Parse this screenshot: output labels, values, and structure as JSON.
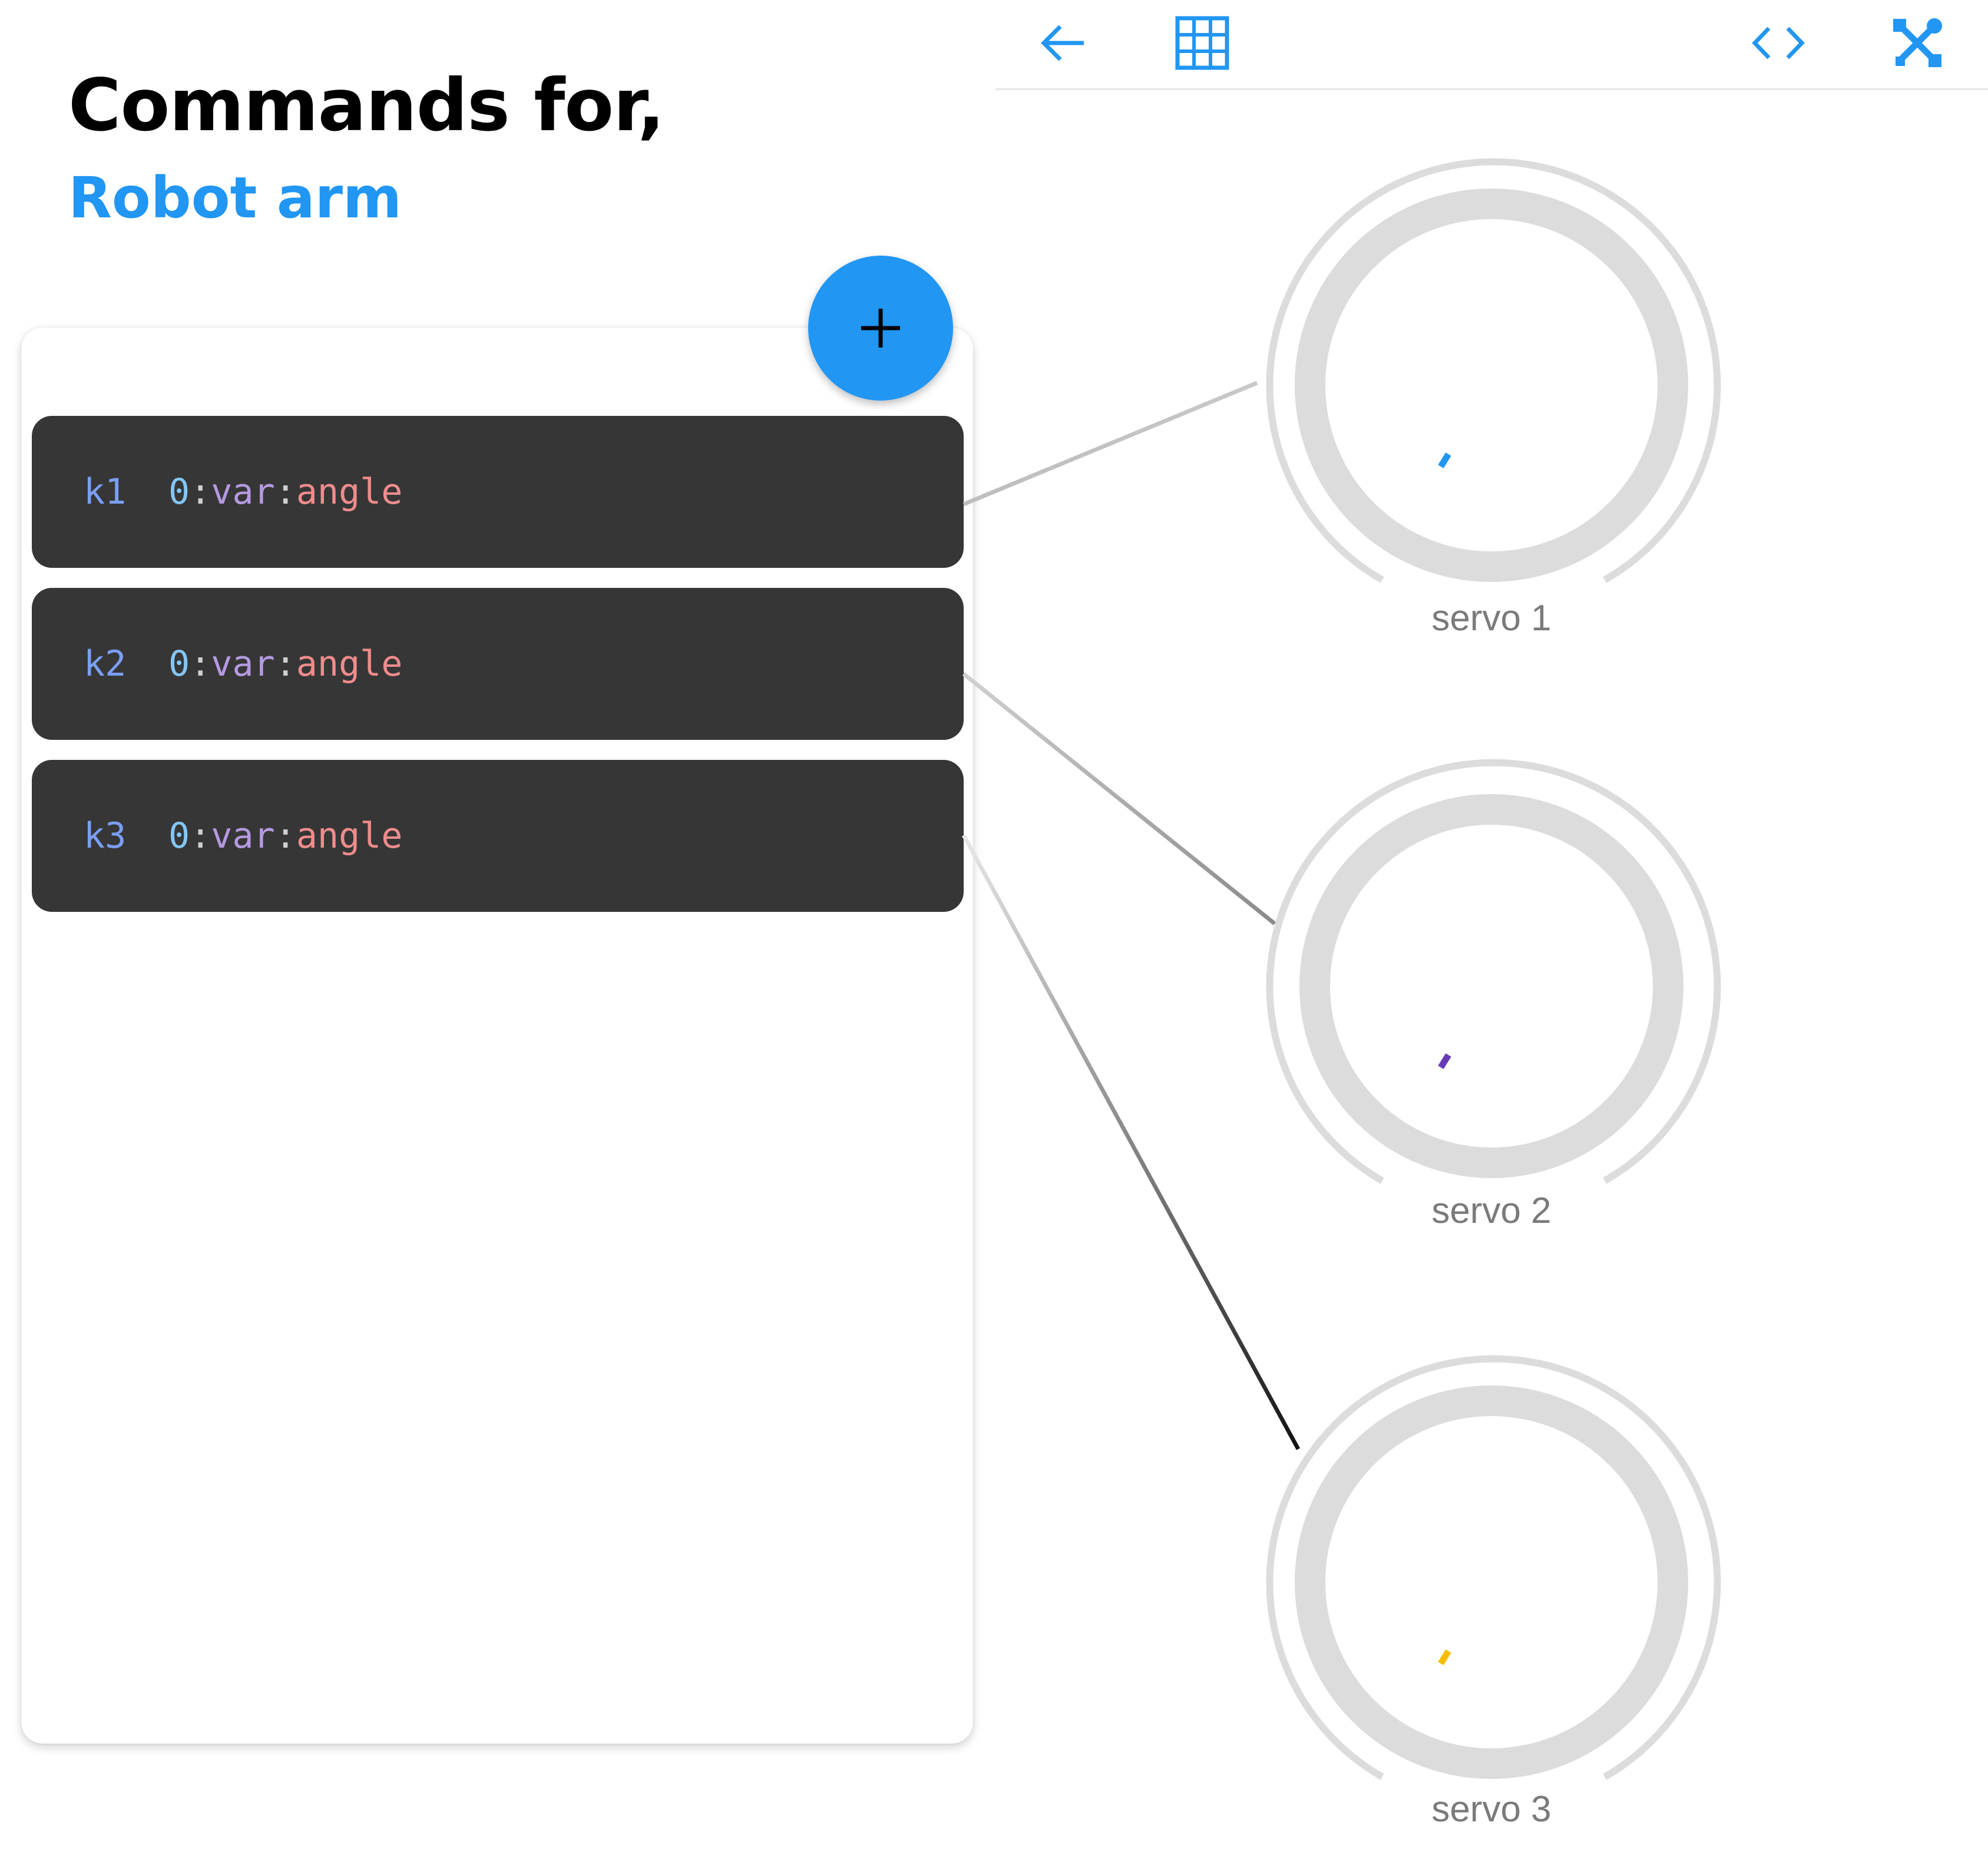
{
  "header": {
    "title": "Commands for,",
    "device_name": "Robot arm"
  },
  "add_button": {
    "label": "+"
  },
  "commands": [
    {
      "key": "k1",
      "index": "0",
      "sep1": ":",
      "kind": "var",
      "sep2": ":",
      "name": "angle"
    },
    {
      "key": "k2",
      "index": "0",
      "sep1": ":",
      "kind": "var",
      "sep2": ":",
      "name": "angle"
    },
    {
      "key": "k3",
      "index": "0",
      "sep1": ":",
      "kind": "var",
      "sep2": ":",
      "name": "angle"
    }
  ],
  "toolbar": {
    "icons": [
      "back-arrow-icon",
      "grid-icon",
      "code-icon",
      "tools-icon"
    ]
  },
  "servos": [
    {
      "label": "servo 1",
      "indicator_color": "#2196f3"
    },
    {
      "label": "servo 2",
      "indicator_color": "#673ab7"
    },
    {
      "label": "servo 3",
      "indicator_color": "#f5bd00"
    }
  ],
  "colors": {
    "accent": "#2196f3",
    "card_bg": "#363636",
    "knob_ring": "#dcdcdc",
    "label_gray": "#7a7a7a"
  }
}
